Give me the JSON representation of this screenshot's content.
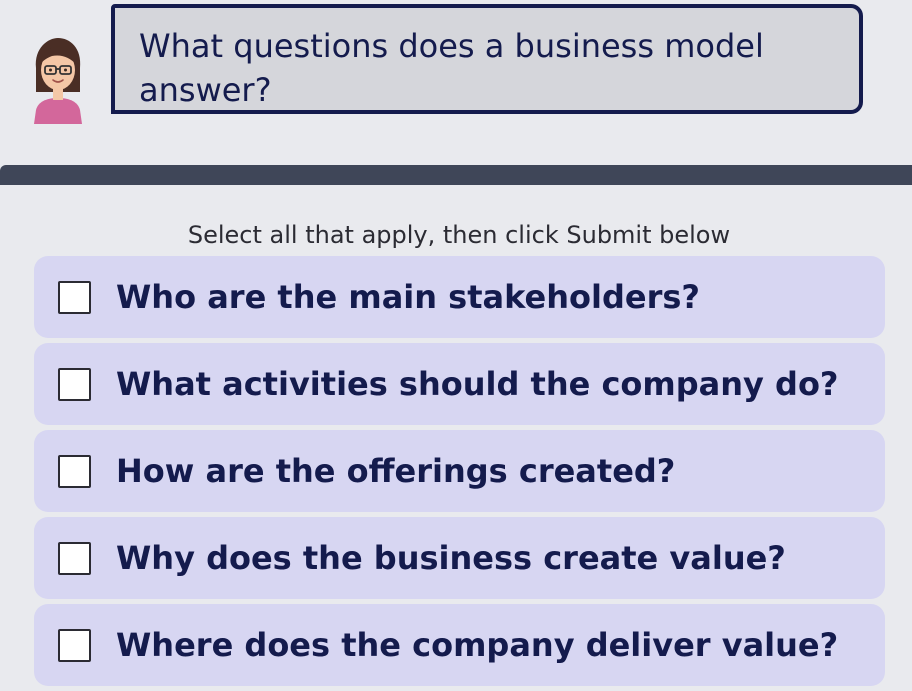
{
  "question": {
    "text": "What questions does a business model answer?"
  },
  "avatar": {
    "icon": "tutor-avatar-icon"
  },
  "instructions": "Select all that apply, then click Submit below",
  "options": [
    {
      "label": "Who are the main stakeholders?",
      "checked": false
    },
    {
      "label": "What activities should the company do?",
      "checked": false
    },
    {
      "label": "How are the offerings created?",
      "checked": false
    },
    {
      "label": "Why does the business create value?",
      "checked": false
    },
    {
      "label": "Where does the company deliver value?",
      "checked": false
    }
  ],
  "colors": {
    "background": "#e9eaee",
    "bubble": "#d5d6db",
    "bubble_border": "#141b4d",
    "divider": "#3f4658",
    "option_background": "#d7d6f2",
    "text": "#141b4d"
  }
}
